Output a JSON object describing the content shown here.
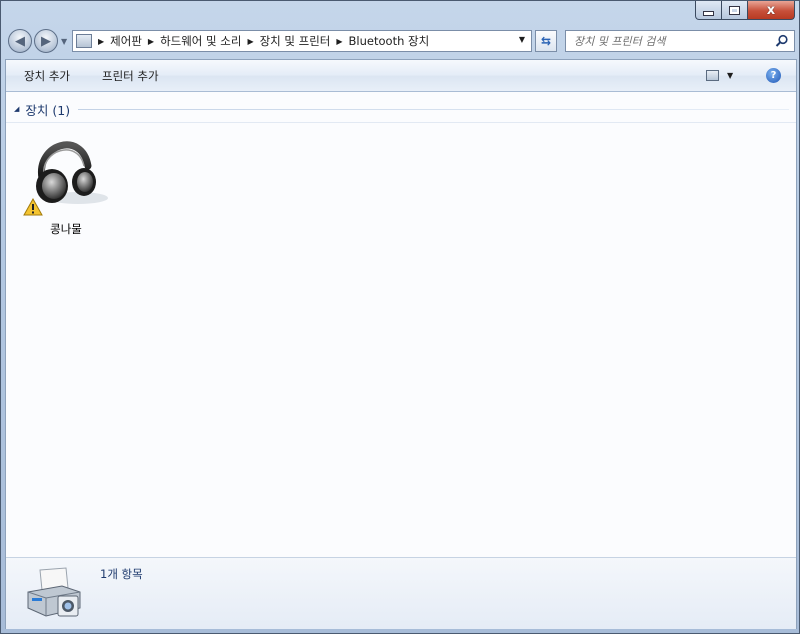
{
  "window": {
    "caption": {
      "minimize": "",
      "maximize": "",
      "close": "x"
    }
  },
  "nav": {
    "breadcrumbs": [
      "제어판",
      "하드웨어 및 소리",
      "장치 및 프린터",
      "Bluetooth 장치"
    ],
    "search_placeholder": "장치 및 프린터 검색"
  },
  "toolbar": {
    "add_device_label": "장치 추가",
    "add_printer_label": "프린터 추가",
    "help_label": "?"
  },
  "group": {
    "title": "장치 (1)"
  },
  "devices": [
    {
      "name": "콩나물",
      "icon": "headphones-icon",
      "status_icon": "warning-icon"
    }
  ],
  "details": {
    "item_count": "1개 항목",
    "icon": "printer-icon"
  },
  "colors": {
    "group_title": "#1e3a6e",
    "close_button": "#c7503a",
    "help_icon": "#1f57b6"
  }
}
